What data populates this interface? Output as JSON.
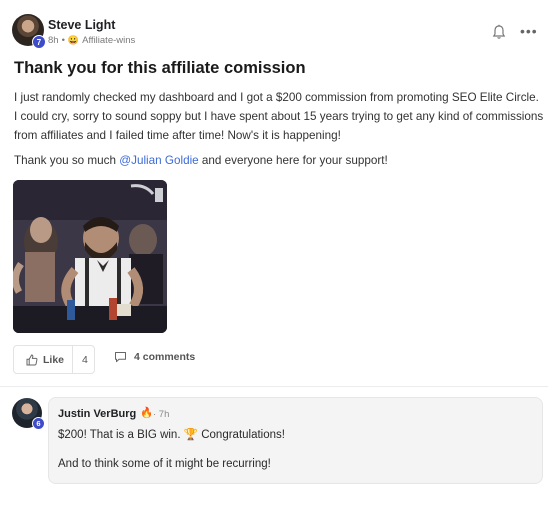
{
  "post": {
    "author": {
      "name": "Steve Light",
      "level": "7",
      "time_ago": "8h",
      "separator": "•",
      "category_emoji": "😀",
      "category": "Affiliate-wins"
    },
    "title": "Thank you for this affiliate comission",
    "body_paragraph_1": "I just randomly checked my dashboard and I got a $200 commission from promoting SEO Elite Circle. I could cry, sorry to sound soppy but I have spent about 15 years trying to get any kind of commissions from affiliates and I failed time after time! Now's it is happening!",
    "body_paragraph_2_prefix": "Thank you so much ",
    "mention": "@Julian Goldie",
    "body_paragraph_2_suffix": " and everyone here for your support!",
    "actions": {
      "like_label": "Like",
      "like_count": "4",
      "comments_label": "4 comments"
    },
    "icons": {
      "bell": "bell-icon",
      "more": "more-options-icon",
      "like": "thumbs-up-icon",
      "comment": "comment-bubble-icon"
    }
  },
  "comment": {
    "author_name": "Justin VerBurg",
    "author_level": "6",
    "flame": "🔥",
    "time_ago": "· 7h",
    "line_1": "$200! That is a BIG win. 🏆 Congratulations!",
    "line_2": "And to think some of it might be recurring!"
  },
  "colors": {
    "mention": "#3d6bd8",
    "level_badge": "#3e4cc9"
  }
}
